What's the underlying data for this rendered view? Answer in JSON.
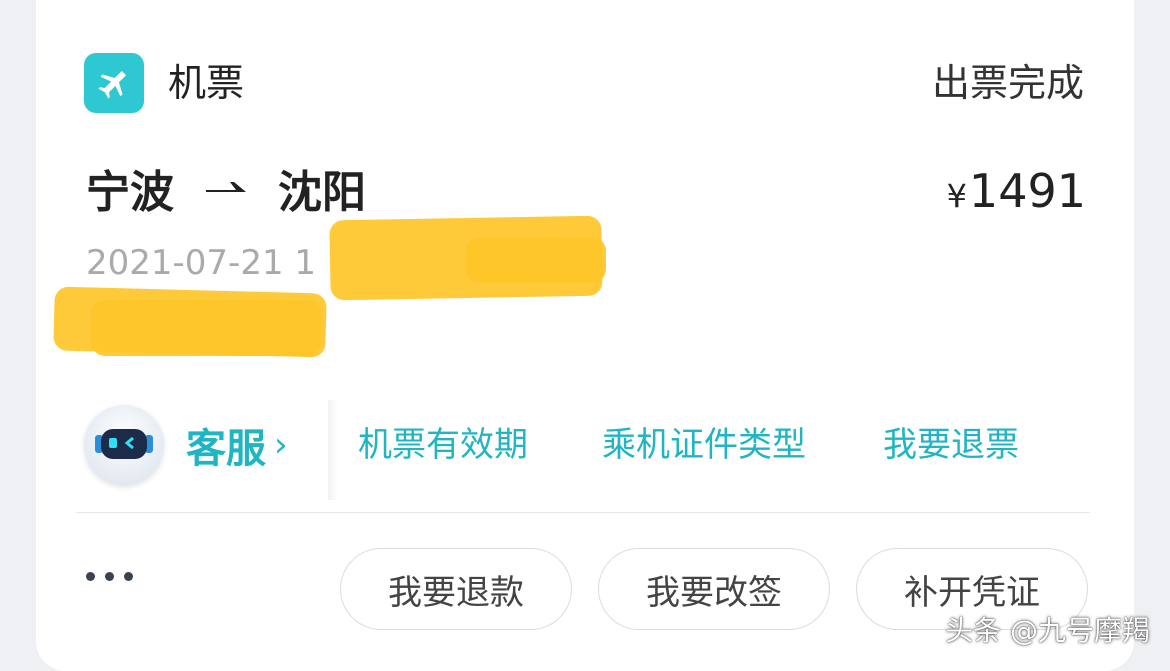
{
  "header": {
    "app_name": "机票",
    "status": "出票完成",
    "icon": "airplane-icon",
    "accent": "#2ec8d3"
  },
  "trip": {
    "origin": "宁波",
    "destination": "沈阳",
    "price_currency": "¥",
    "price_amount": "1491",
    "date": "2021-07-21 1"
  },
  "quick_links": {
    "service_label": "客服",
    "service_chevron": "›",
    "links": [
      "机票有效期",
      "乘机证件类型",
      "我要退票"
    ],
    "link_color": "#20b5c3"
  },
  "actions": {
    "more": "more-dots-icon",
    "buttons": [
      "我要退款",
      "我要改签",
      "补开凭证"
    ]
  },
  "watermark": "头条 @九号摩羯"
}
